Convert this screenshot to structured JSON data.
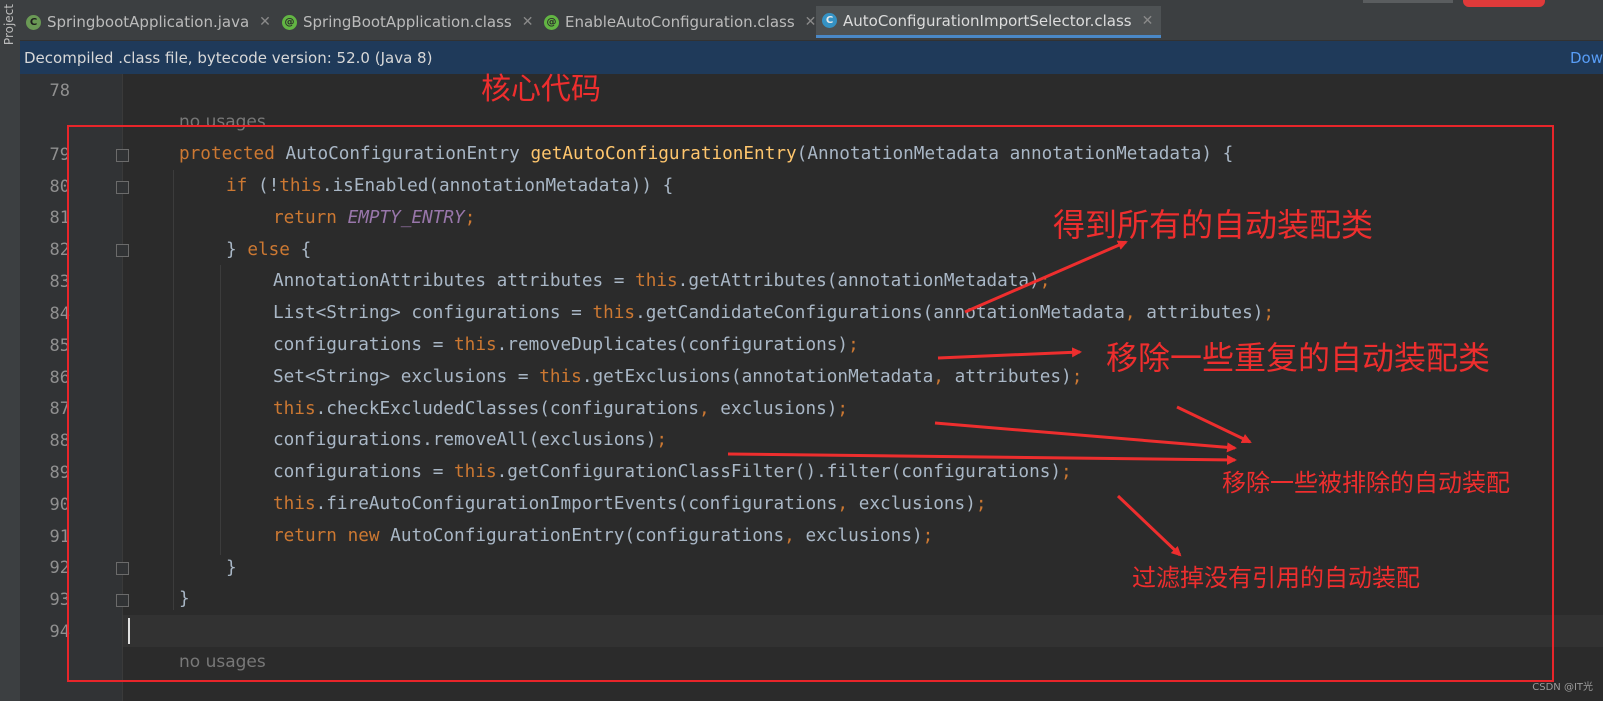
{
  "tool_strip": {
    "label": "Project"
  },
  "tabs": [
    {
      "label": "SpringbootApplication.java",
      "icon": "spring-boot-class-icon"
    },
    {
      "label": "SpringBootApplication.class",
      "icon": "annotation-icon"
    },
    {
      "label": "EnableAutoConfiguration.class",
      "icon": "annotation-icon"
    },
    {
      "label": "AutoConfigurationImportSelector.class",
      "icon": "class-icon",
      "active": true
    }
  ],
  "banner": {
    "message": "Decompiled .class file, bytecode version: 52.0 (Java 8)",
    "action": "Dow"
  },
  "editor": {
    "usage_hint": "no usages",
    "line_numbers": [
      "78",
      "79",
      "80",
      "81",
      "82",
      "83",
      "84",
      "85",
      "86",
      "87",
      "88",
      "89",
      "90",
      "91",
      "92",
      "93",
      "94"
    ],
    "code": {
      "l79": {
        "kw": "protected",
        "type": "AutoConfigurationEntry",
        "method": "getAutoConfigurationEntry",
        "args": "(AnnotationMetadata annotationMetadata) {"
      },
      "l80": {
        "kw": "if",
        "pre": " (!",
        "this": "this",
        "rest": ".isEnabled(annotationMetadata)) {"
      },
      "l81": {
        "kw": "return",
        "const": "EMPTY_ENTRY",
        "semi": ";"
      },
      "l82": {
        "open": "} ",
        "kw": "else",
        "rest": " {"
      },
      "l83": {
        "pre": "AnnotationAttributes attributes = ",
        "this": "this",
        "rest": ".getAttributes(annotationMetadata)",
        "semi": ";"
      },
      "l84": {
        "pre": "List<String> configurations = ",
        "this": "this",
        "rest": ".getCandidateConfigurations(annotationMetadata",
        "comma": ",",
        "rest2": " attributes)",
        "semi": ";"
      },
      "l85": {
        "pre": "configurations = ",
        "this": "this",
        "rest": ".removeDuplicates(configurations)",
        "semi": ";"
      },
      "l86": {
        "pre": "Set<String> exclusions = ",
        "this": "this",
        "rest": ".getExclusions(annotationMetadata",
        "comma": ",",
        "rest2": " attributes)",
        "semi": ";"
      },
      "l87": {
        "this": "this",
        "rest": ".checkExcludedClasses(configurations",
        "comma": ",",
        "rest2": " exclusions)",
        "semi": ";"
      },
      "l88": {
        "pre": "configurations.removeAll(exclusions)",
        "semi": ";"
      },
      "l89": {
        "pre": "configurations = ",
        "this": "this",
        "rest": ".getConfigurationClassFilter().filter(configurations)",
        "semi": ";"
      },
      "l90": {
        "this": "this",
        "rest": ".fireAutoConfigurationImportEvents(configurations",
        "comma": ",",
        "rest2": " exclusions)",
        "semi": ";"
      },
      "l91": {
        "kw": "return",
        "kw2": "new",
        "rest": " AutoConfigurationEntry(configurations",
        "comma": ",",
        "rest2": " exclusions)",
        "semi": ";"
      },
      "l92": {
        "text": "}"
      },
      "l93": {
        "text": "}"
      }
    }
  },
  "annotations": {
    "title": "核心代码",
    "get_all": "得到所有的自动装配类",
    "remove_duplicates": "移除一些重复的自动装配类",
    "remove_excluded": "移除一些被排除的自动装配",
    "filter_unused": "过滤掉没有引用的自动装配",
    "color": "#ee2e2e"
  },
  "watermark": "CSDN @IT光"
}
